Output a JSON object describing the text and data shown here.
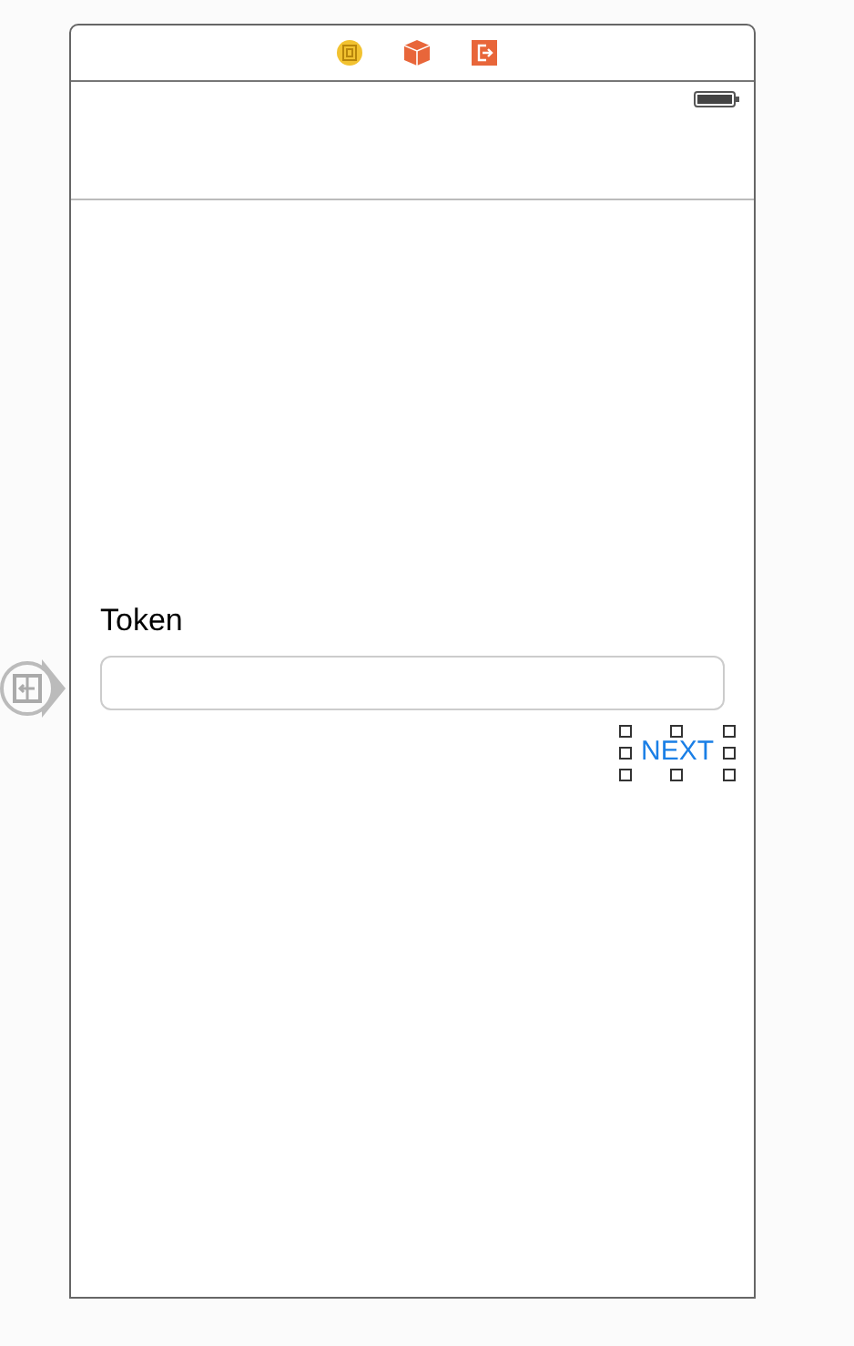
{
  "scene_dock": [
    {
      "kind": "view-controller"
    },
    {
      "kind": "first-responder"
    },
    {
      "kind": "exit"
    }
  ],
  "entry_point": true,
  "form": {
    "label": "Token",
    "field": {
      "kind": "text"
    },
    "button": {
      "label": "NEXT",
      "selected": true
    }
  }
}
